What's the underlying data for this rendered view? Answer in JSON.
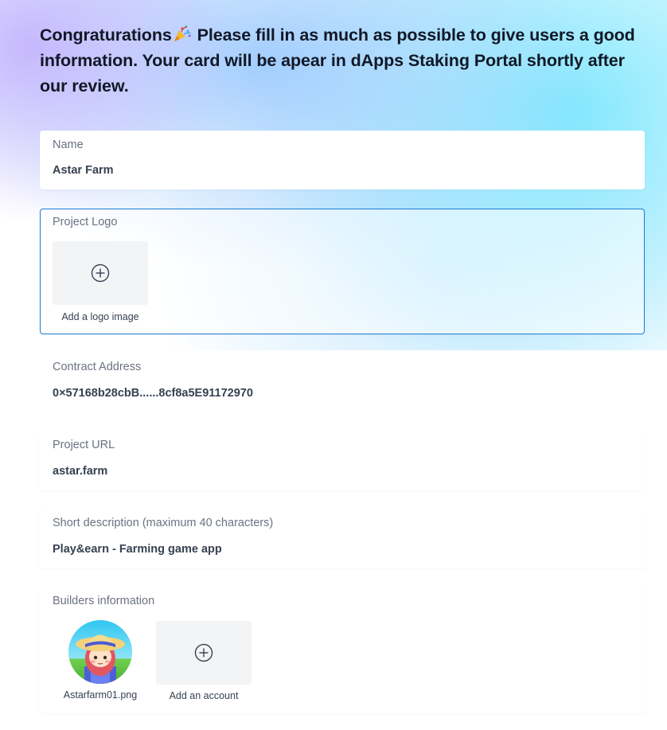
{
  "intro": {
    "text_before_emoji": "Congraturations",
    "emoji_icon": "party-popper-icon",
    "text_after_emoji": " Please fill in as much as possible to give users a good information. Your card will be apear in dApps Staking Portal shortly after our review."
  },
  "fields": {
    "name": {
      "label": "Name",
      "value": "Astar Farm"
    },
    "project_logo": {
      "label": "Project Logo",
      "add_caption": "Add a logo image",
      "add_icon": "plus-circle-icon"
    },
    "contract_address": {
      "label": "Contract Address",
      "value": "0×57168b28cbB......8cf8a5E91172970"
    },
    "project_url": {
      "label": "Project URL",
      "value": "astar.farm"
    },
    "short_description": {
      "label": "Short description (maximum 40 characters)",
      "value": "Play&earn - Farming game app"
    },
    "builders": {
      "label": "Builders information",
      "accounts": [
        {
          "file_name": "Astarfarm01.png",
          "avatar_icon": "farmer-girl-avatar"
        }
      ],
      "add_caption": "Add an account",
      "add_icon": "plus-circle-icon"
    }
  },
  "colors": {
    "focus_border": "#1d7bd9",
    "heading_text": "#111827",
    "label_text": "#6b7280",
    "value_text": "#374151",
    "tile_background": "#f3f4f6"
  }
}
